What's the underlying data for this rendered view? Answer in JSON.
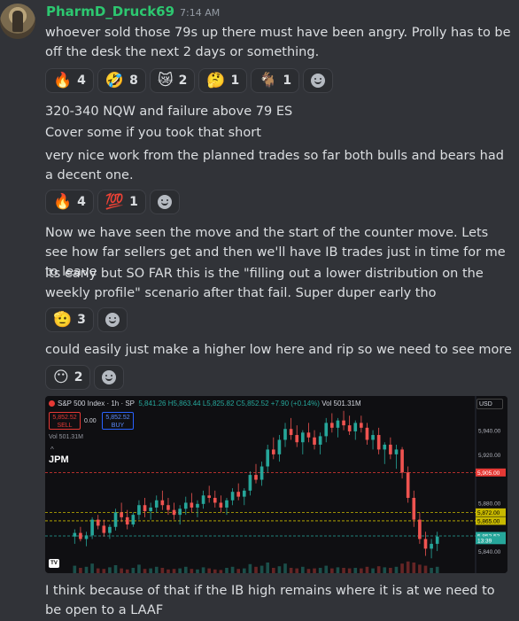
{
  "message": {
    "username": "PharmD_Druck69",
    "timestamp": "7:14 AM",
    "blocks": [
      {
        "text": "whoever sold those 79s up there must have been angry. Prolly has to be off the desk the next 2 days or something."
      },
      {
        "text": "320-340 NQW and failure above 79 ES"
      },
      {
        "text": "Cover some if you took that short"
      },
      {
        "text": "very nice work from the planned trades so far both bulls and bears had a decent one."
      },
      {
        "text": "Now we have seen the move and the start of the counter move. Lets see how far sellers get and then we'll have IB trades just in time for me to leave"
      },
      {
        "text": "its early but SO FAR this is the \"filling out a lower distribution on the weekly profile\" scenario after that fail. Super duper early tho"
      },
      {
        "text": "could easily just make a higher low here and rip so we need to see more"
      },
      {
        "text": "I think because of that if the IB high remains where it is at we need to be open to a LAAF"
      }
    ]
  },
  "reactions": {
    "r1": [
      {
        "emoji": "🔥",
        "icon": "fire-icon",
        "count": "4"
      },
      {
        "emoji": "🤣",
        "icon": "rofl-icon",
        "count": "8"
      },
      {
        "emoji": "😿",
        "icon": "crying-cat-icon",
        "count": "2"
      },
      {
        "emoji": "🤔",
        "icon": "thinking-icon",
        "count": "1"
      },
      {
        "emoji": "🐐",
        "icon": "goat-icon",
        "count": "1"
      }
    ],
    "r2": [
      {
        "emoji": "🔥",
        "icon": "fire-icon",
        "count": "4"
      },
      {
        "emoji": "💯",
        "icon": "hundred-icon",
        "count": "1"
      }
    ],
    "r3": [
      {
        "emoji": "🫡",
        "icon": "saluting-face-icon",
        "count": "3"
      }
    ],
    "r4": [
      {
        "emoji": "😶",
        "icon": "no-mouth-face-icon",
        "count": "2"
      }
    ]
  },
  "chart_attachment": {
    "symbol_line": "S&P 500 Index · 1h · SP",
    "ohlc_text": "5,841.26  H5,863.44  L5,825.82  C5,852.52",
    "change_text": "+7.90 (+0.14%)",
    "vol_text": "Vol 501.31M",
    "sell_price": "5,852.52",
    "sell_label": "SELL",
    "spread": "0.00",
    "buy_price": "5,852.52",
    "buy_label": "BUY",
    "vol_sub": "Vol  501.31M",
    "indicator_label": "JPM",
    "currency": "USD",
    "tv_logo": "TV",
    "colors": {
      "up": "#26a69a",
      "down": "#ef5350",
      "red_line": "#e53935",
      "yellow_line": "#c8b900",
      "bg": "#0f0f12"
    }
  },
  "chart_data": {
    "type": "candlestick",
    "y_ticks": [
      "5,940.00",
      "5,920.00",
      "5,880.00",
      "5,840.00"
    ],
    "ylim": [
      5832,
      5958
    ],
    "price_labels": [
      {
        "text": "5,905.00",
        "value": 5905,
        "color": "#e53935"
      },
      {
        "text": "5,872.00",
        "value": 5872,
        "color": "#c8b900"
      },
      {
        "text": "5,865.00",
        "value": 5865,
        "color": "#c8b900"
      },
      {
        "text": "5,852.52",
        "value": 5852.52,
        "color": "#26a69a"
      },
      {
        "text": "13:39",
        "value": 5849,
        "color": "#26a69a"
      }
    ],
    "hlines": [
      {
        "value": 5905,
        "color": "#e53935"
      },
      {
        "value": 5872,
        "color": "#c8b900"
      },
      {
        "value": 5865,
        "color": "#c8b900"
      },
      {
        "value": 5852.52,
        "color": "#26a69a"
      }
    ],
    "candles": [
      [
        5852,
        5858,
        5846,
        5855
      ],
      [
        5855,
        5860,
        5848,
        5850
      ],
      [
        5850,
        5856,
        5844,
        5853
      ],
      [
        5853,
        5868,
        5850,
        5866
      ],
      [
        5866,
        5870,
        5858,
        5861
      ],
      [
        5861,
        5866,
        5852,
        5855
      ],
      [
        5855,
        5862,
        5850,
        5860
      ],
      [
        5860,
        5875,
        5857,
        5872
      ],
      [
        5872,
        5880,
        5864,
        5868
      ],
      [
        5868,
        5874,
        5858,
        5862
      ],
      [
        5862,
        5872,
        5860,
        5870
      ],
      [
        5870,
        5882,
        5866,
        5878
      ],
      [
        5878,
        5884,
        5868,
        5873
      ],
      [
        5873,
        5880,
        5866,
        5876
      ],
      [
        5876,
        5886,
        5872,
        5882
      ],
      [
        5882,
        5890,
        5874,
        5878
      ],
      [
        5878,
        5884,
        5870,
        5874
      ],
      [
        5874,
        5880,
        5866,
        5870
      ],
      [
        5870,
        5878,
        5862,
        5875
      ],
      [
        5875,
        5885,
        5870,
        5880
      ],
      [
        5880,
        5888,
        5872,
        5876
      ],
      [
        5876,
        5882,
        5868,
        5879
      ],
      [
        5879,
        5890,
        5875,
        5886
      ],
      [
        5886,
        5894,
        5880,
        5884
      ],
      [
        5884,
        5890,
        5876,
        5880
      ],
      [
        5880,
        5886,
        5872,
        5876
      ],
      [
        5876,
        5884,
        5870,
        5882
      ],
      [
        5882,
        5892,
        5878,
        5889
      ],
      [
        5889,
        5896,
        5882,
        5885
      ],
      [
        5885,
        5892,
        5878,
        5890
      ],
      [
        5890,
        5906,
        5886,
        5903
      ],
      [
        5903,
        5912,
        5896,
        5899
      ],
      [
        5899,
        5914,
        5894,
        5910
      ],
      [
        5910,
        5928,
        5905,
        5924
      ],
      [
        5924,
        5934,
        5916,
        5920
      ],
      [
        5920,
        5936,
        5914,
        5932
      ],
      [
        5932,
        5946,
        5926,
        5941
      ],
      [
        5941,
        5950,
        5932,
        5936
      ],
      [
        5936,
        5944,
        5926,
        5930
      ],
      [
        5930,
        5940,
        5920,
        5938
      ],
      [
        5938,
        5946,
        5930,
        5934
      ],
      [
        5934,
        5940,
        5924,
        5928
      ],
      [
        5928,
        5938,
        5920,
        5935
      ],
      [
        5935,
        5950,
        5930,
        5946
      ],
      [
        5946,
        5954,
        5938,
        5942
      ],
      [
        5942,
        5950,
        5934,
        5948
      ],
      [
        5948,
        5956,
        5940,
        5944
      ],
      [
        5944,
        5952,
        5936,
        5939
      ],
      [
        5939,
        5948,
        5932,
        5946
      ],
      [
        5946,
        5952,
        5938,
        5942
      ],
      [
        5942,
        5946,
        5928,
        5932
      ],
      [
        5932,
        5940,
        5924,
        5936
      ],
      [
        5936,
        5942,
        5920,
        5924
      ],
      [
        5924,
        5930,
        5912,
        5928
      ],
      [
        5928,
        5934,
        5916,
        5920
      ],
      [
        5920,
        5928,
        5908,
        5924
      ],
      [
        5924,
        5926,
        5900,
        5905
      ],
      [
        5905,
        5910,
        5880,
        5884
      ],
      [
        5884,
        5890,
        5860,
        5866
      ],
      [
        5866,
        5872,
        5846,
        5850
      ],
      [
        5850,
        5856,
        5836,
        5842
      ],
      [
        5842,
        5850,
        5834,
        5846
      ],
      [
        5846,
        5856,
        5840,
        5852
      ]
    ],
    "volume": [
      14,
      10,
      12,
      18,
      9,
      8,
      11,
      15,
      9,
      7,
      10,
      16,
      8,
      9,
      12,
      10,
      7,
      8,
      9,
      12,
      8,
      7,
      11,
      9,
      7,
      6,
      10,
      12,
      8,
      9,
      17,
      12,
      14,
      20,
      10,
      13,
      18,
      10,
      9,
      12,
      8,
      9,
      10,
      14,
      9,
      11,
      10,
      9,
      10,
      9,
      12,
      9,
      13,
      11,
      10,
      12,
      18,
      22,
      20,
      16,
      14,
      10,
      12
    ]
  }
}
